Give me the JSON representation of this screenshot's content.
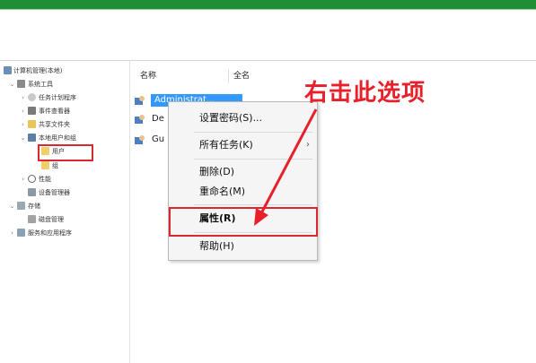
{
  "tree": {
    "root": "计算机管理(本地)",
    "system_tools": "系统工具",
    "task_scheduler": "任务计划程序",
    "event_viewer": "事件查看器",
    "shared_folders": "共享文件夹",
    "local_users_groups": "本地用户和组",
    "users": "用户",
    "groups": "组",
    "performance": "性能",
    "device_manager": "设备管理器",
    "storage": "存储",
    "disk_management": "磁盘管理",
    "services_apps": "服务和应用程序"
  },
  "list": {
    "columns": [
      "名称",
      "全名"
    ],
    "rows": [
      {
        "name": "Administrat...",
        "selected": true
      },
      {
        "name": "De",
        "selected": false
      },
      {
        "name": "Gu",
        "selected": false
      }
    ]
  },
  "context_menu": {
    "set_password": "设置密码(S)...",
    "all_tasks": "所有任务(K)",
    "submenu_arrow": "›",
    "delete": "删除(D)",
    "rename": "重命名(M)",
    "properties": "属性(R)",
    "help": "帮助(H)"
  },
  "annotation": {
    "text": "右击此选项",
    "color": "#e8202a"
  },
  "colors": {
    "titlebar": "#1f8f35",
    "selection": "#3399ff",
    "highlight_box": "#d9282e"
  }
}
